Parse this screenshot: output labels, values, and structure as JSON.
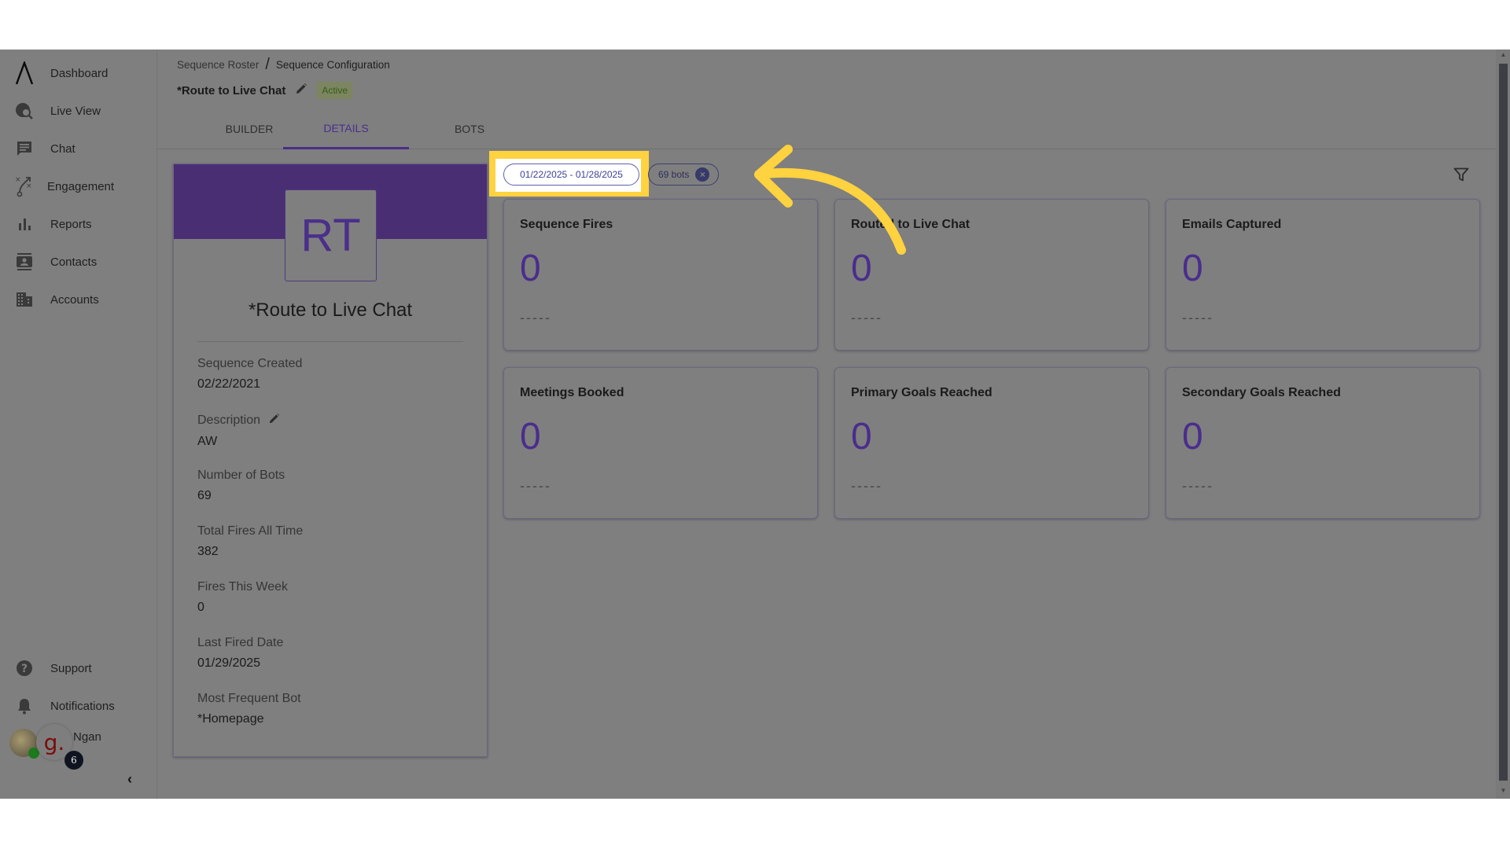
{
  "sidebar": {
    "items": [
      {
        "label": "Dashboard",
        "icon": "logo-icon"
      },
      {
        "label": "Live View",
        "icon": "live-view-icon"
      },
      {
        "label": "Chat",
        "icon": "chat-icon"
      },
      {
        "label": "Engagement",
        "icon": "engagement-icon"
      },
      {
        "label": "Reports",
        "icon": "reports-icon"
      },
      {
        "label": "Contacts",
        "icon": "contacts-icon"
      },
      {
        "label": "Accounts",
        "icon": "accounts-icon"
      }
    ],
    "bottom": [
      {
        "label": "Support",
        "icon": "help-icon"
      },
      {
        "label": "Notifications",
        "icon": "bell-icon"
      }
    ],
    "user": {
      "name": "Ngan",
      "brand_letter": "g.",
      "badge_count": "6"
    },
    "collapse_glyph": "‹"
  },
  "breadcrumb": {
    "parent": "Sequence Roster",
    "separator": "/",
    "current": "Sequence Configuration"
  },
  "header": {
    "title": "*Route to Live Chat",
    "status": "Active"
  },
  "tabs": [
    {
      "label": "BUILDER",
      "active": false
    },
    {
      "label": "DETAILS",
      "active": true
    },
    {
      "label": "BOTS",
      "active": false
    }
  ],
  "profile": {
    "initials": "RT",
    "name": "*Route to Live Chat",
    "fields": [
      {
        "label": "Sequence Created",
        "value": "02/22/2021"
      },
      {
        "label": "Description",
        "value": "AW",
        "editable": true
      },
      {
        "label": "Number of Bots",
        "value": "69"
      },
      {
        "label": "Total Fires All Time",
        "value": "382"
      },
      {
        "label": "Fires This Week",
        "value": "0"
      },
      {
        "label": "Last Fired Date",
        "value": "01/29/2025"
      },
      {
        "label": "Most Frequent Bot",
        "value": "*Homepage"
      }
    ]
  },
  "filters": {
    "date_range": "01/22/2025 - 01/28/2025",
    "bots_chip": "69 bots"
  },
  "stats": [
    {
      "title": "Sequence Fires",
      "value": "0",
      "delta": "-----"
    },
    {
      "title": "Routed to Live Chat",
      "value": "0",
      "delta": "-----"
    },
    {
      "title": "Emails Captured",
      "value": "0",
      "delta": "-----"
    },
    {
      "title": "Meetings Booked",
      "value": "0",
      "delta": "-----"
    },
    {
      "title": "Primary Goals Reached",
      "value": "0",
      "delta": "-----"
    },
    {
      "title": "Secondary Goals Reached",
      "value": "0",
      "delta": "-----"
    }
  ],
  "colors": {
    "accent": "#4a2d8c",
    "banner": "#4a2e74",
    "highlight": "#ffd23f",
    "overlay": "#7f7f7f"
  }
}
